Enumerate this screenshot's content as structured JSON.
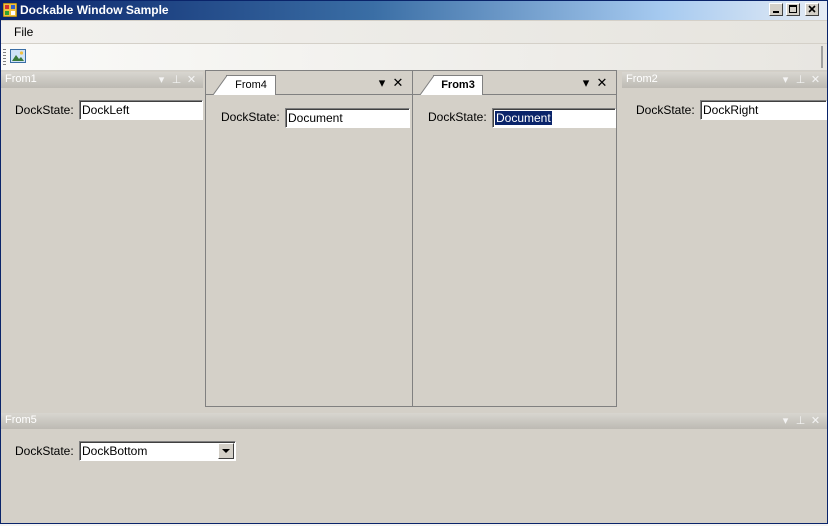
{
  "window": {
    "title": "Dockable Window Sample"
  },
  "menu": {
    "file": "File"
  },
  "toolbar": {
    "button_icon": "image-icon"
  },
  "panes": {
    "from1": {
      "title": "From1",
      "label": "DockState:",
      "value": "DockLeft"
    },
    "from2": {
      "title": "From2",
      "label": "DockState:",
      "value": "DockRight"
    },
    "from3": {
      "tab": "From3",
      "label": "DockState:",
      "value": "Document"
    },
    "from4": {
      "tab": "From4",
      "label": "DockState:",
      "value": "Document"
    },
    "from5": {
      "title": "From5",
      "label": "DockState:",
      "value": "DockBottom"
    }
  },
  "glyphs": {
    "dropdown": "▾",
    "pin": "⊥",
    "close": "✕",
    "minimize": "_",
    "maximize": "□"
  },
  "colors": {
    "titlebar_start": "#0a246a",
    "panel": "#d4d0c8",
    "selection": "#0a246a"
  }
}
